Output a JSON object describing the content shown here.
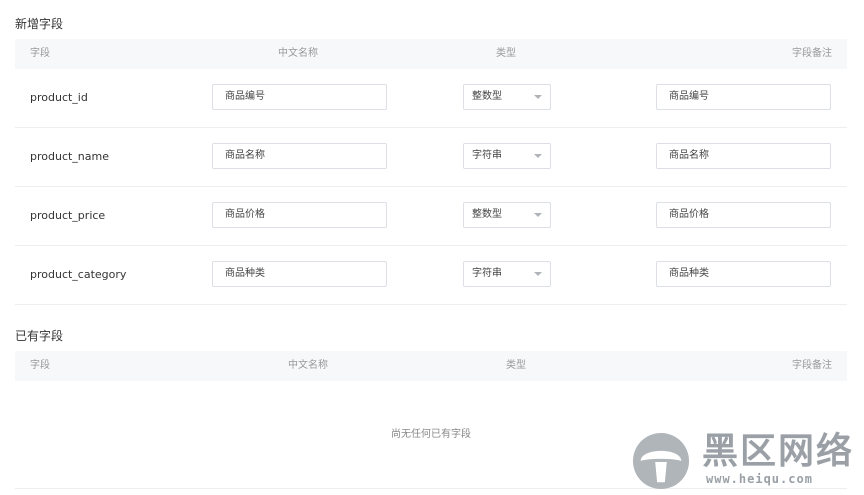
{
  "new_section": {
    "title": "新增字段",
    "headers": {
      "field": "字段",
      "cn_name": "中文名称",
      "type": "类型",
      "remark": "字段备注"
    },
    "rows": [
      {
        "field": "product_id",
        "cn_name": "商品编号",
        "type": "整数型",
        "remark": "商品编号"
      },
      {
        "field": "product_name",
        "cn_name": "商品名称",
        "type": "字符串",
        "remark": "商品名称"
      },
      {
        "field": "product_price",
        "cn_name": "商品价格",
        "type": "整数型",
        "remark": "商品价格"
      },
      {
        "field": "product_category",
        "cn_name": "商品种类",
        "type": "字符串",
        "remark": "商品种类"
      }
    ]
  },
  "existing_section": {
    "title": "已有字段",
    "headers": {
      "field": "字段",
      "cn_name": "中文名称",
      "type": "类型",
      "remark": "字段备注"
    },
    "empty_text": "尚无任何已有字段"
  },
  "watermark": {
    "title": "黑区网络",
    "url": "www.heiqu.com"
  },
  "colors": {
    "header_bg": "#f7f8fa",
    "border": "#dcdfe6",
    "watermark": "#9aa0a6"
  }
}
